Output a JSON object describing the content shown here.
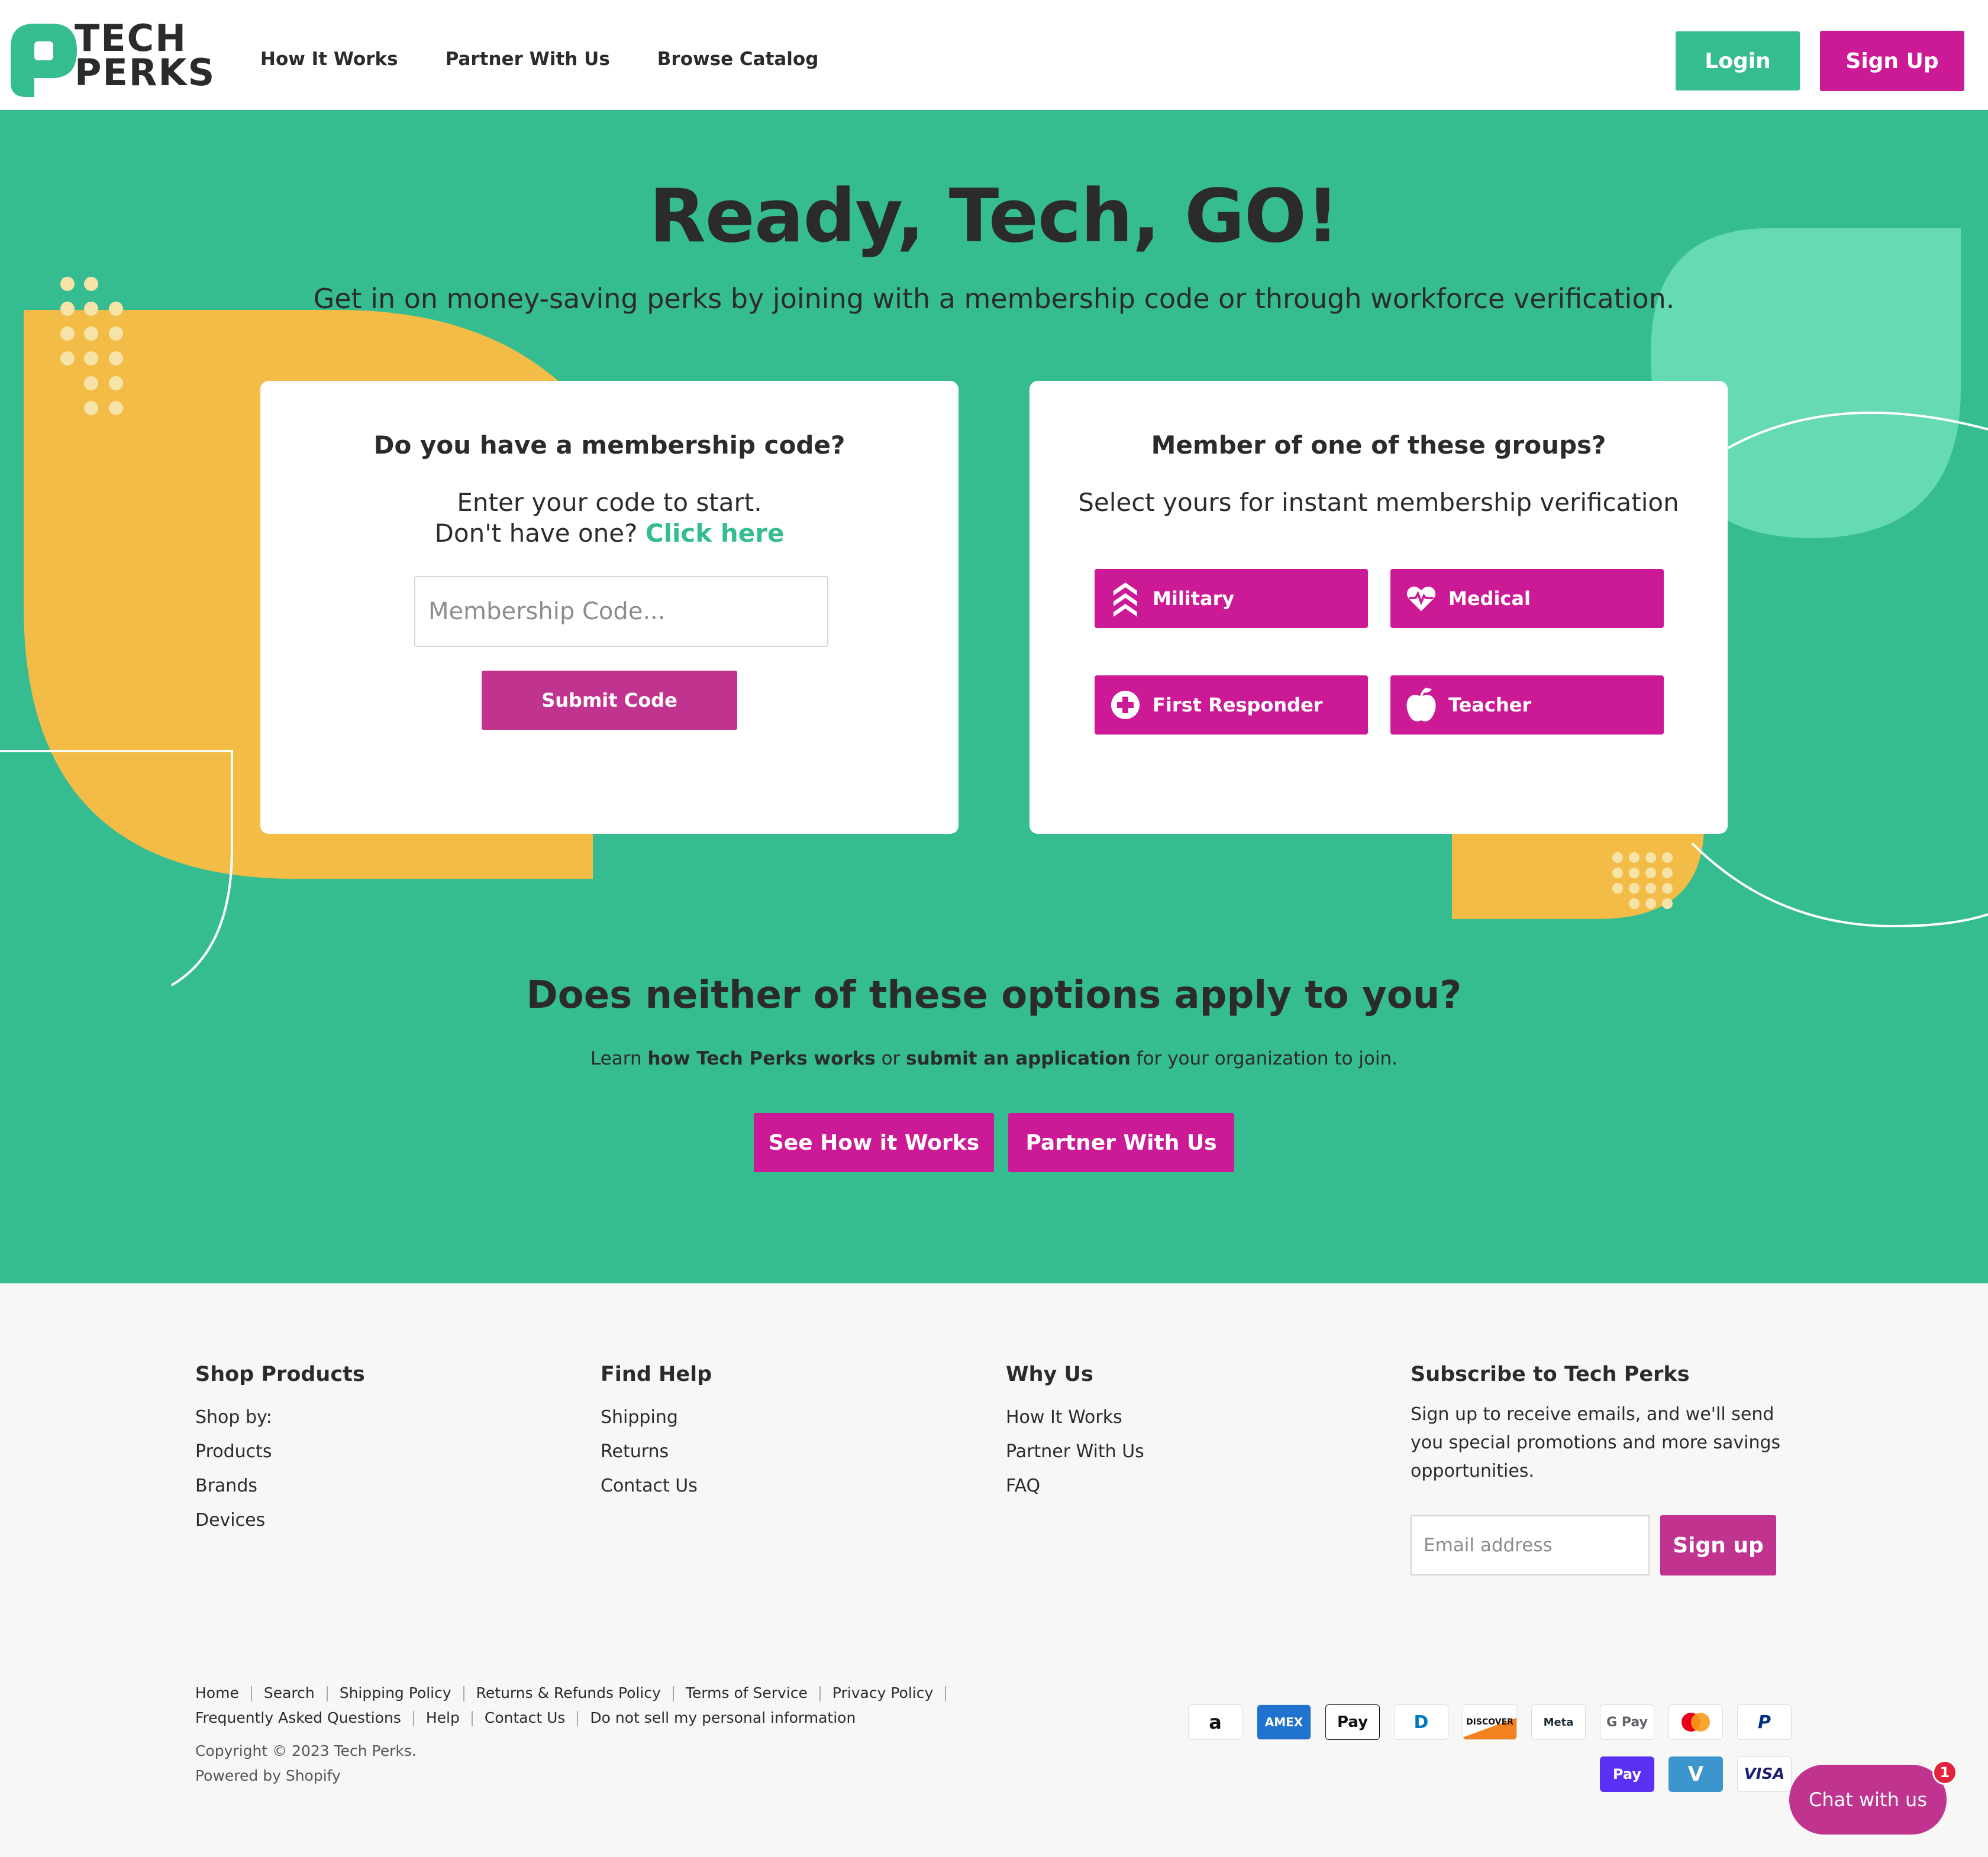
{
  "header": {
    "logo_line1": "TECH",
    "logo_line2": "PERKS",
    "nav": [
      "How It Works",
      "Partner With Us",
      "Browse Catalog"
    ],
    "login_label": "Login",
    "signup_label": "Sign Up"
  },
  "hero": {
    "title": "Ready, Tech, GO!",
    "subtitle": "Get in on money-saving perks by joining with a membership code or through workforce verification."
  },
  "code_card": {
    "title": "Do you have a membership code?",
    "line1": "Enter your code to start.",
    "line2_prefix": "Don't have one? ",
    "line2_link": "Click here",
    "input_placeholder": "Membership Code...",
    "submit_label": "Submit Code"
  },
  "groups_card": {
    "title": "Member of one of these groups?",
    "subtitle": "Select yours for instant membership verification",
    "buttons": [
      {
        "label": "Military",
        "icon": "military-chevron-icon"
      },
      {
        "label": "Medical",
        "icon": "heart-pulse-icon"
      },
      {
        "label": "First Responder",
        "icon": "plus-circle-icon"
      },
      {
        "label": "Teacher",
        "icon": "apple-icon"
      }
    ]
  },
  "neither": {
    "title": "Does neither of these options apply to you?",
    "sub_1": "Learn ",
    "sub_bold_1": "how Tech Perks works",
    "sub_2": " or ",
    "sub_bold_2": "submit an application",
    "sub_3": " for your organization to join.",
    "how_label": "See How it Works",
    "partner_label": "Partner With Us"
  },
  "footer": {
    "shop": {
      "title": "Shop Products",
      "items": [
        "Shop by:",
        "Products",
        "Brands",
        "Devices"
      ]
    },
    "help": {
      "title": "Find Help",
      "items": [
        "Shipping",
        "Returns",
        "Contact Us"
      ]
    },
    "why": {
      "title": "Why Us",
      "items": [
        "How It Works",
        "Partner With Us",
        "FAQ"
      ]
    },
    "subscribe": {
      "title": "Subscribe to Tech Perks",
      "text": "Sign up to receive emails, and we'll send you special promotions and more savings opportunities.",
      "email_placeholder": "Email address",
      "button_label": "Sign up"
    },
    "legal_links": [
      "Home",
      "Search",
      "Shipping Policy",
      "Returns & Refunds Policy",
      "Terms of Service",
      "Privacy Policy",
      "Frequently Asked Questions",
      "Help",
      "Contact Us",
      "Do not sell my personal information"
    ],
    "copyright": "Copyright © 2023 Tech Perks.",
    "powered": "Powered by Shopify",
    "payments": [
      "a",
      "AMEX",
      "Pay",
      "D",
      "DISCOVER",
      "Meta",
      "G Pay",
      "mastercard",
      "P",
      "Pay",
      "V",
      "VISA"
    ]
  },
  "chat": {
    "label": "Chat with us",
    "badge": "1"
  },
  "colors": {
    "brand_green": "#36bc91",
    "brand_magenta": "#cc1a97",
    "accent_yellow": "#f2bc47",
    "light_green": "#65dab5"
  }
}
